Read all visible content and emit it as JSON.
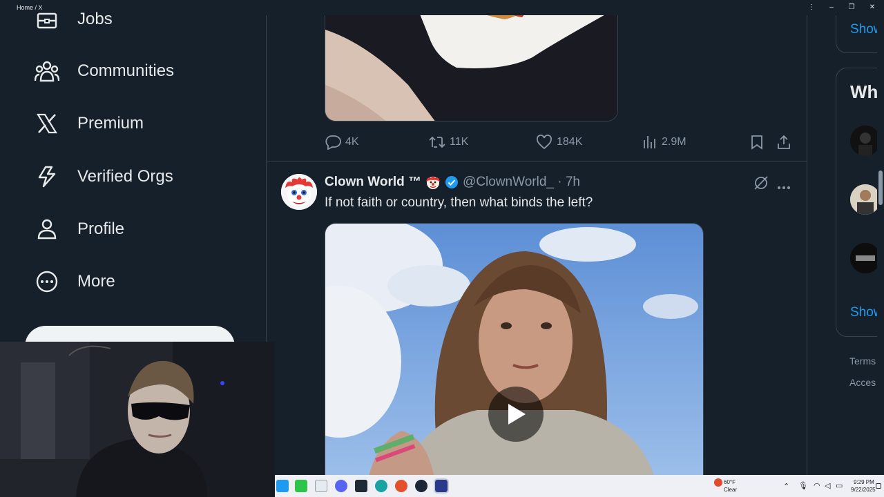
{
  "window": {
    "title": "Home / X",
    "controls": [
      "⋮",
      "–",
      "❐",
      "✕"
    ]
  },
  "sidebar": {
    "items": [
      {
        "label": "Jobs",
        "icon": "jobs-icon"
      },
      {
        "label": "Communities",
        "icon": "communities-icon"
      },
      {
        "label": "Premium",
        "icon": "x-logo-icon"
      },
      {
        "label": "Verified Orgs",
        "icon": "lightning-icon"
      },
      {
        "label": "Profile",
        "icon": "person-icon"
      },
      {
        "label": "More",
        "icon": "more-circle-icon"
      }
    ]
  },
  "feed": {
    "previous_post": {
      "replies": "4K",
      "reposts": "11K",
      "likes": "184K",
      "views": "2.9M"
    },
    "tweet": {
      "name": "Clown World ™",
      "handle": "@ClownWorld_ · 7h",
      "text": "If not faith or country, then what binds the left?",
      "verified": true,
      "media": "video"
    }
  },
  "right_sidebar": {
    "show_more_1": "Show",
    "who_to_follow_title": "Wh",
    "show_more_2": "Show",
    "footer_terms": "Terms",
    "footer_access": "Acces"
  },
  "taskbar": {
    "weather_temp": "60°F",
    "weather_desc": "Clear",
    "time": "9:29 PM",
    "date": "9/22/2025"
  },
  "colors": {
    "background": "#15202b",
    "border": "#38444d",
    "text": "#e7e9ea",
    "muted": "#8b98a5",
    "accent": "#1d9bf0"
  }
}
